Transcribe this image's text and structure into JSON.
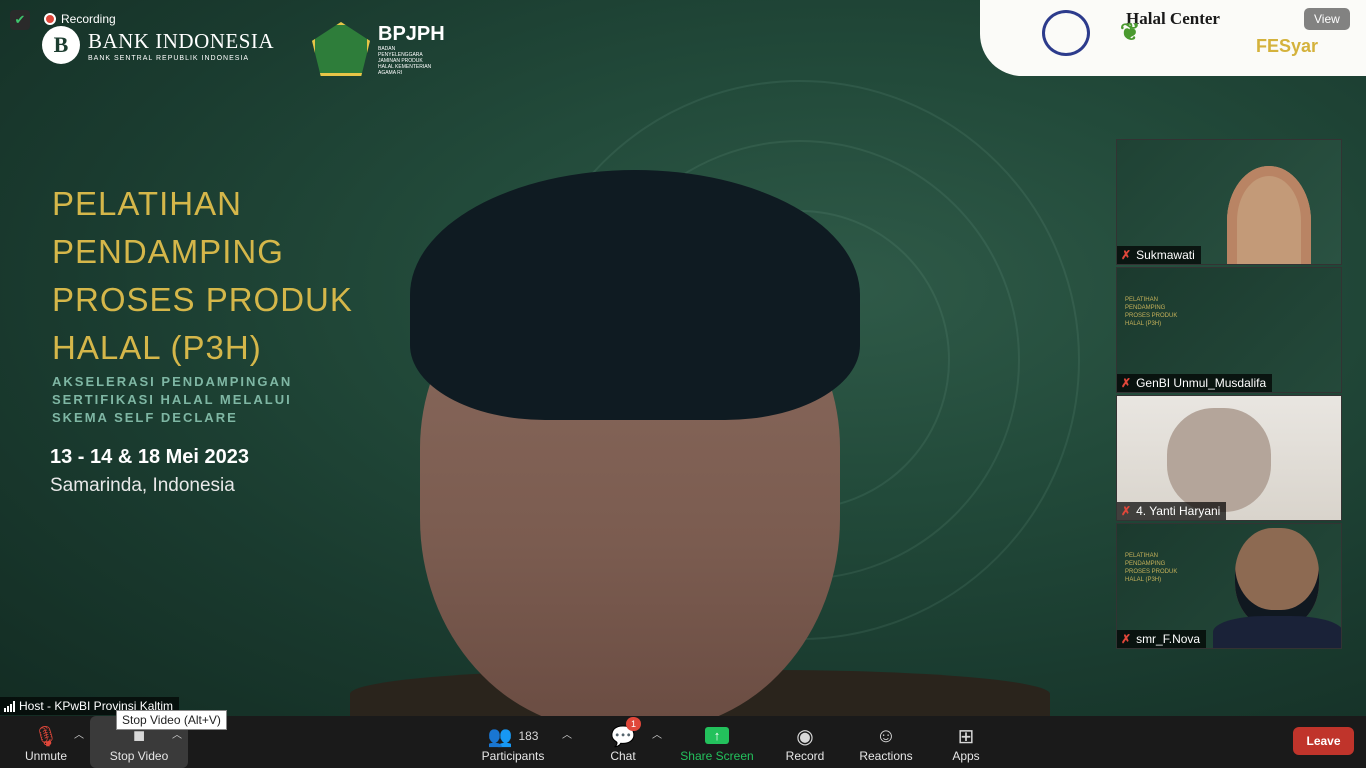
{
  "status": {
    "recording_label": "Recording",
    "view_label": "View"
  },
  "banner": {
    "bi_title": "BANK INDONESIA",
    "bi_subtitle": "BANK SENTRAL REPUBLIK INDONESIA",
    "bi_mark": "B",
    "bpjph_title": "BPJPH",
    "bpjph_subtitle": "BADAN PENYELENGGARA JAMINAN PRODUK HALAL KEMENTERIAN AGAMA RI",
    "partner_halal": "Halal Center",
    "partner_fesyar": "FESyar"
  },
  "event": {
    "title_lines": [
      "PELATIHAN",
      "PENDAMPING",
      "PROSES PRODUK",
      "HALAL (P3H)"
    ],
    "subtitle_lines": [
      "AKSELERASI PENDAMPINGAN",
      "SERTIFIKASI HALAL MELALUI",
      "SKEMA SELF DECLARE"
    ],
    "date": "13 - 14 & 18 Mei 2023",
    "place": "Samarinda, Indonesia"
  },
  "main_speaker": {
    "name": "Host - KPwBI Provinsi Kaltim"
  },
  "tooltip": "Stop Video (Alt+V)",
  "participants": [
    {
      "name": "Sukmawati"
    },
    {
      "name": "GenBI Unmul_Musdalifa"
    },
    {
      "name": "4. Yanti Haryani"
    },
    {
      "name": "smr_F.Nova"
    }
  ],
  "thumb_slide": [
    "PELATIHAN",
    "PENDAMPING",
    "PROSES PRODUK",
    "HALAL (P3H)"
  ],
  "toolbar": {
    "unmute": "Unmute",
    "stop_video": "Stop Video",
    "participants": "Participants",
    "participants_count": "183",
    "chat": "Chat",
    "chat_badge": "1",
    "share_screen": "Share Screen",
    "record": "Record",
    "reactions": "Reactions",
    "apps": "Apps",
    "leave": "Leave"
  },
  "colors": {
    "accent_gold": "#d5b74a",
    "share_green": "#23c15c",
    "leave_red": "#c0342b",
    "mute_red": "#e0473a"
  }
}
